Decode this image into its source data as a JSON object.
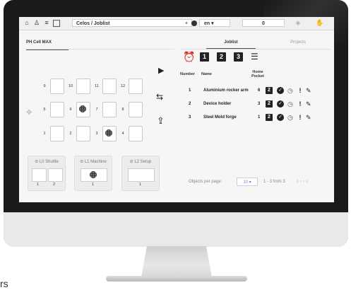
{
  "topbar": {
    "home_icon": "home-icon",
    "path": "Celos / Joblist",
    "path_star": "✦",
    "language": "en ▾",
    "count": "0"
  },
  "left_panel": {
    "tab": "PH Cell MAX",
    "rows": [
      {
        "slots": [
          {
            "num": "9"
          },
          {
            "num": "10"
          },
          {
            "num": "11"
          },
          {
            "num": "12"
          }
        ]
      },
      {
        "slots": [
          {
            "num": "5"
          },
          {
            "num": "6"
          },
          {
            "num": "7"
          },
          {
            "num": "8"
          }
        ]
      },
      {
        "slots": [
          {
            "num": "1"
          },
          {
            "num": "2"
          },
          {
            "num": "3"
          },
          {
            "num": "4"
          }
        ]
      }
    ],
    "stations": [
      {
        "label": "⊘ L0 Shuttle",
        "nums": [
          "1",
          "2"
        ]
      },
      {
        "label": "⊘ L1 Machine",
        "nums": [
          "1"
        ]
      },
      {
        "label": "⊘ L2 Setup",
        "nums": [
          "1"
        ]
      }
    ]
  },
  "right_panel": {
    "tabs": [
      "Joblist",
      "Projects"
    ],
    "filters": [
      "1",
      "2",
      "3"
    ],
    "columns": {
      "number": "Number",
      "name": "Name",
      "home_pocket": "Home Pocket"
    },
    "rows": [
      {
        "number": "1",
        "name": "Aluminium rocker arm",
        "pocket": "6",
        "badge": "2"
      },
      {
        "number": "2",
        "name": "Device holder",
        "pocket": "3",
        "badge": "2"
      },
      {
        "number": "3",
        "name": "Steel Mold forge",
        "pocket": "1",
        "badge": "2"
      }
    ],
    "pager": {
      "label": "Objects per page:",
      "per_page": "10 ▾",
      "range": "1 - 3 from 3",
      "nav": "|‹  ‹  ›  ›|"
    }
  },
  "stray_text": "rs"
}
